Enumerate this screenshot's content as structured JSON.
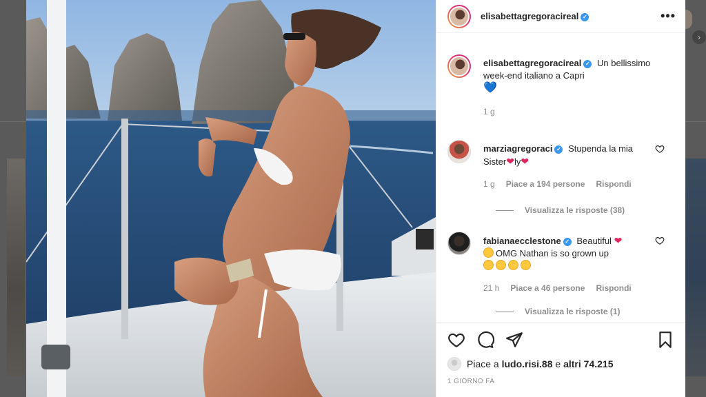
{
  "post": {
    "author": "elisabettagregoracireal",
    "more_icon": "more-horizontal-icon",
    "caption": {
      "username": "elisabettagregoracireal",
      "text": "Un bellissimo week-end italiano a Capri",
      "emoji": "💙",
      "time": "1 g"
    },
    "comments": [
      {
        "username": "marziagregoraci",
        "text_a": "Stupenda la mia Sister",
        "emoji_a": "❤",
        "text_b": "ly",
        "emoji_b": "❤",
        "time": "1 g",
        "likes": "Piace a 194 persone",
        "reply": "Rispondi",
        "view_replies": "Visualizza le risposte (38)"
      },
      {
        "username": "fabianaecclestone",
        "text_a": "Beautiful",
        "emoji_a": "❤",
        "text_b": "OMG Nathan is so grown up",
        "time": "21 h",
        "likes": "Piace a 46 persone",
        "reply": "Rispondi",
        "view_replies": "Visualizza le risposte (1)"
      }
    ],
    "likes": {
      "prefix": "Piace a",
      "user": "ludo.risi.88",
      "middle": "e",
      "others": "altri 74.215"
    },
    "date": "1 GIORNO FA"
  },
  "colors": {
    "verified": "#3897f0",
    "heart": "#e0245e",
    "blue_heart": "#2a75c9",
    "muted": "#8e8e8e",
    "text": "#262626"
  }
}
